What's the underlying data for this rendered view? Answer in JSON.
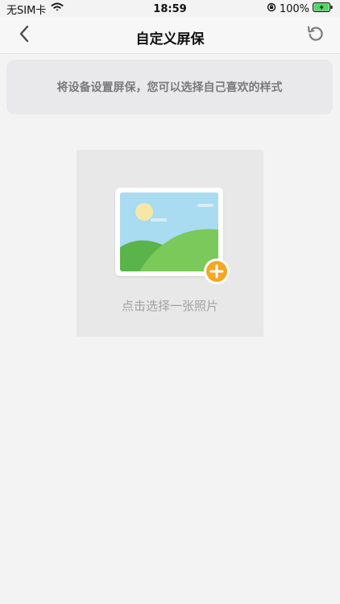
{
  "status_bar": {
    "carrier": "无SIM卡",
    "time": "18:59",
    "battery": "100%"
  },
  "nav": {
    "title": "自定义屏保",
    "back_icon": "chevron-left-icon",
    "refresh_icon": "refresh-icon"
  },
  "banner": {
    "text": "将设备设置屏保，您可以选择自己喜欢的样式"
  },
  "picker": {
    "label": "点击选择一张照片",
    "image_icon": "landscape-photo-icon",
    "add_icon": "plus-circle-icon"
  },
  "colors": {
    "accent": "#f5a623",
    "sky": "#a9dbf1",
    "hill_light": "#7bc95a",
    "hill_dark": "#5ab44a",
    "sun": "#f6e7a7"
  }
}
